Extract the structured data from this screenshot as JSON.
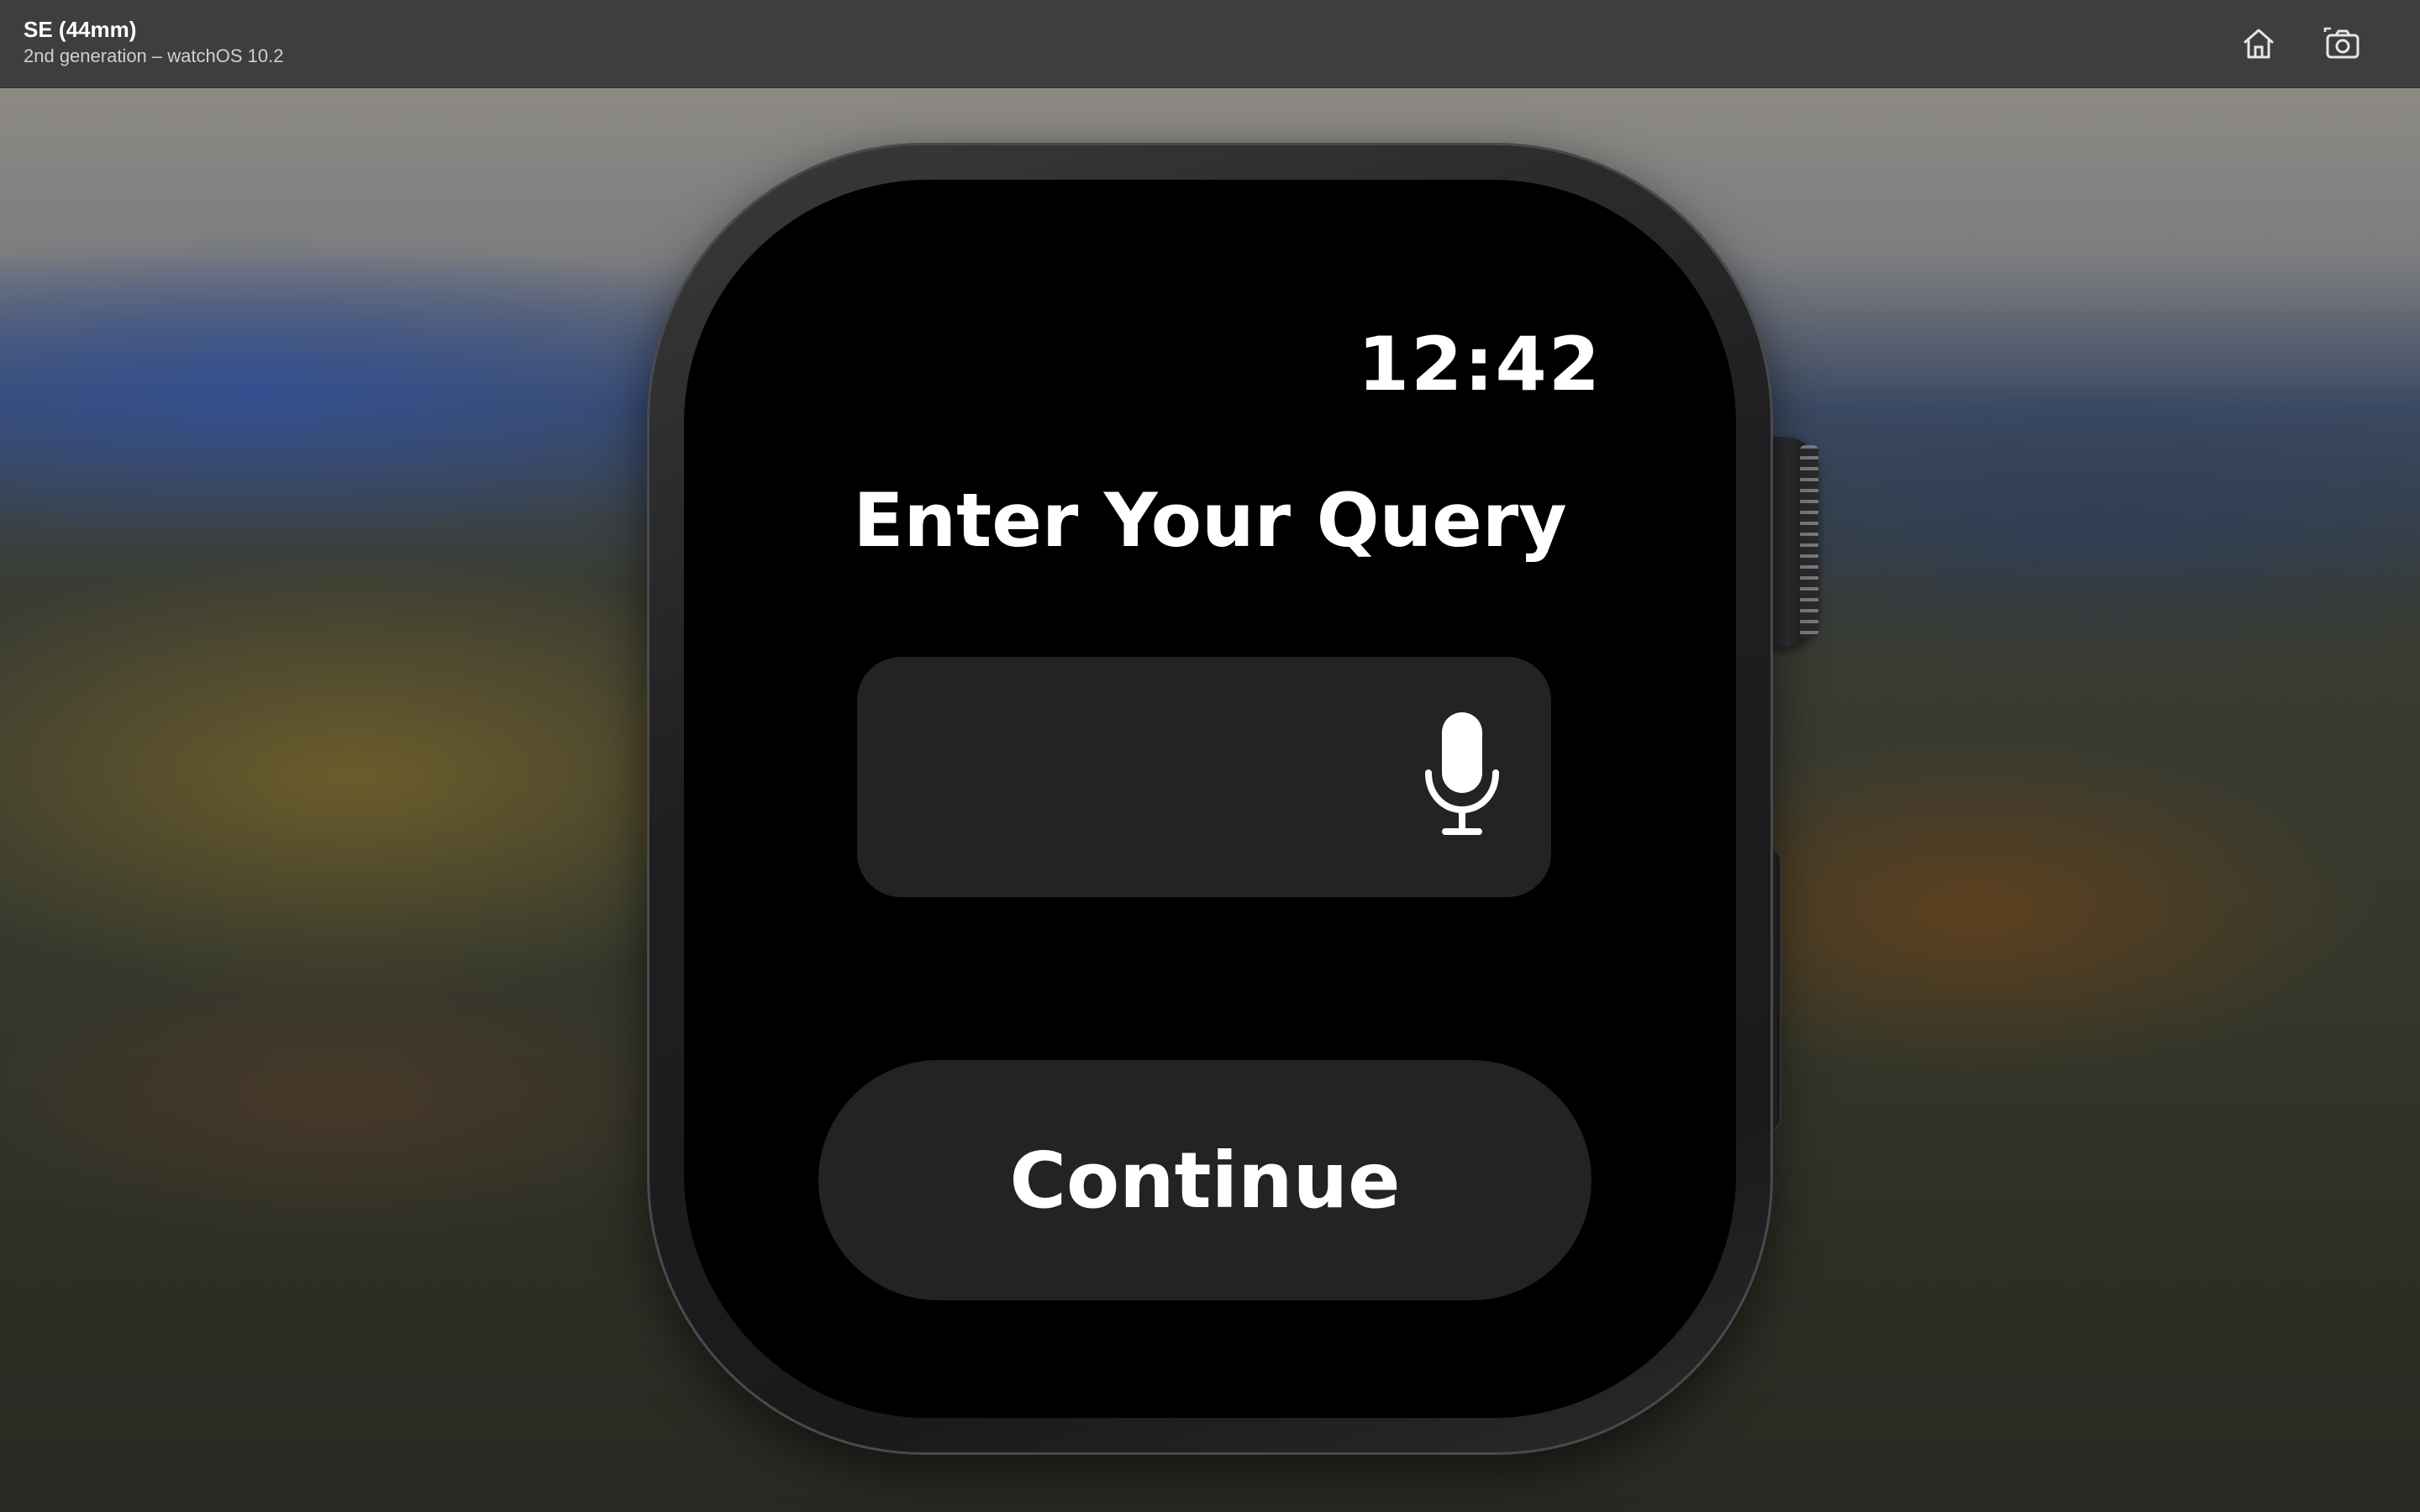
{
  "simulator": {
    "device_name": "SE (44mm)",
    "device_subtitle": "2nd generation – watchOS 10.2",
    "toolbar": [
      {
        "icon": "home-icon",
        "label": "Home"
      },
      {
        "icon": "camera-icon",
        "label": "Screenshot"
      }
    ]
  },
  "watch": {
    "time": "12:42",
    "heading": "Enter Your Query",
    "query_field": {
      "value": "",
      "icon": "microphone-icon"
    },
    "continue_label": "Continue"
  },
  "colors": {
    "titlebar": "#3e3e3e",
    "screen_background": "#000000",
    "control_background": "#232325",
    "text": "#ffffff"
  }
}
